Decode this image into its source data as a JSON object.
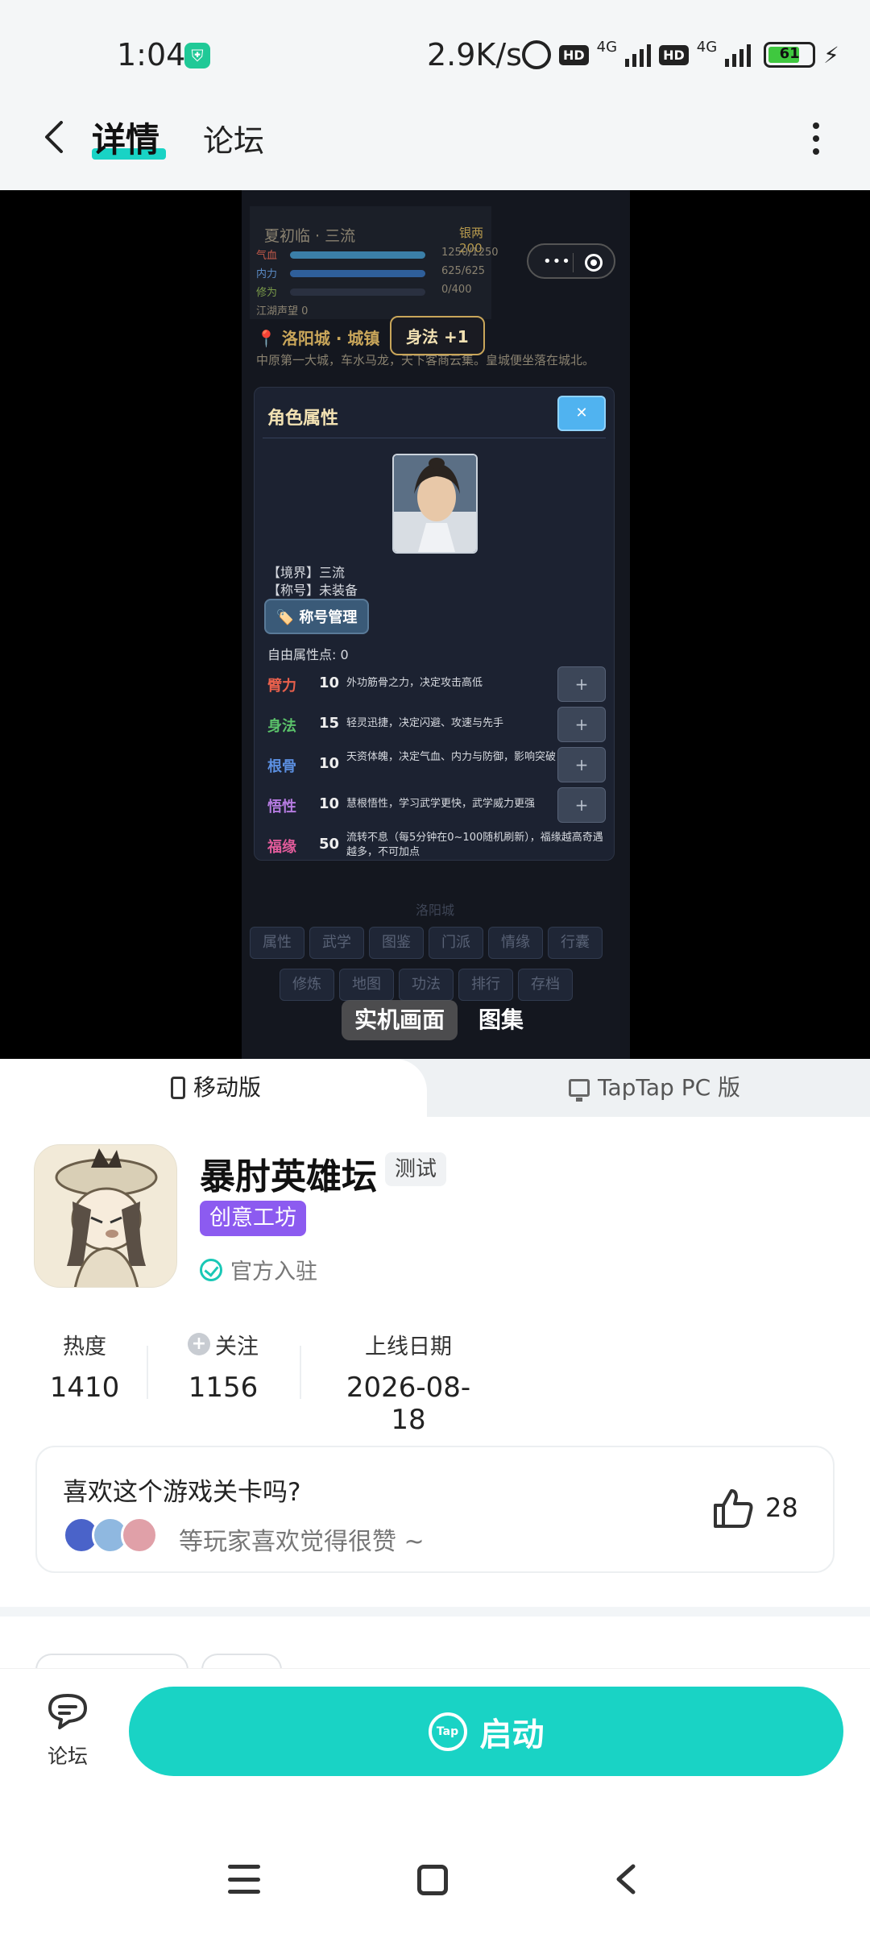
{
  "status_bar": {
    "time": "1:04",
    "net_speed": "2.9K/s",
    "hd1": "HD",
    "net1": "4G",
    "hd2": "HD",
    "net2": "4G",
    "battery": "61"
  },
  "nav": {
    "tab_detail": "详情",
    "tab_forum": "论坛",
    "accent_color": "#19d3c5"
  },
  "screenshot": {
    "name_line": "夏初临 · 三流",
    "money": "银两 200",
    "bars": [
      {
        "label": "气血",
        "value": "1250/1250",
        "fraction": 1.0
      },
      {
        "label": "内力",
        "value": "625/625",
        "fraction": 1.0
      },
      {
        "label": "修为",
        "value": "0/400",
        "fraction": 0.0
      }
    ],
    "fame": "江湖声望 0",
    "location": "📍 洛阳城 · 城镇",
    "location_desc": "中原第一大城，车水马龙，天下客商云集。皇城便坐落在城北。",
    "toast": "身法 +1",
    "panel_title": "角色属性",
    "realm": "【境界】三流",
    "title_equipped": "【称号】未装备",
    "title_manage": "🏷️ 称号管理",
    "free_points": "自由属性点: 0",
    "attributes": [
      {
        "name": "臂力",
        "value": "10",
        "desc": "外功筋骨之力，决定攻击高低",
        "color": "#e8604c"
      },
      {
        "name": "身法",
        "value": "15",
        "desc": "轻灵迅捷，决定闪避、攻速与先手",
        "color": "#5bc26a"
      },
      {
        "name": "根骨",
        "value": "10",
        "desc": "天资体魄，决定气血、内力与防御，影响突破",
        "color": "#5b8fe0"
      },
      {
        "name": "悟性",
        "value": "10",
        "desc": "慧根悟性，学习武学更快，武学威力更强",
        "color": "#b57be0"
      },
      {
        "name": "福缘",
        "value": "50",
        "desc": "流转不息（每5分钟在0~100随机刷新），福缘越高奇遇越多，不可加点",
        "color": "#e05b9a"
      }
    ],
    "plus": "+",
    "city": "洛阳城",
    "bottom_tabs_row1": [
      "属性",
      "武学",
      "图鉴",
      "门派",
      "情缘",
      "行囊"
    ],
    "bottom_tabs_row2": [
      "修炼",
      "地图",
      "功法",
      "排行",
      "存档"
    ]
  },
  "media_tabs": {
    "real": "实机画面",
    "gallery": "图集"
  },
  "platform": {
    "mobile": "移动版",
    "pc": "TapTap PC 版"
  },
  "game": {
    "title": "暴肘英雄坛",
    "test_badge": "测试",
    "workshop_badge": "创意工坊",
    "official": "官方入驻"
  },
  "stats": {
    "heat_label": "热度",
    "heat_value": "1410",
    "follow_label": "关注",
    "follow_value": "1156",
    "launch_label": "上线日期",
    "launch_value": "2026-08-18"
  },
  "like_card": {
    "question": "喜欢这个游戏关卡吗?",
    "subtitle": "等玩家喜欢觉得很赞 ~",
    "count": "28"
  },
  "bottom_bar": {
    "forum_label": "论坛",
    "launch_label": "启动",
    "tap_logo": "Tap"
  }
}
